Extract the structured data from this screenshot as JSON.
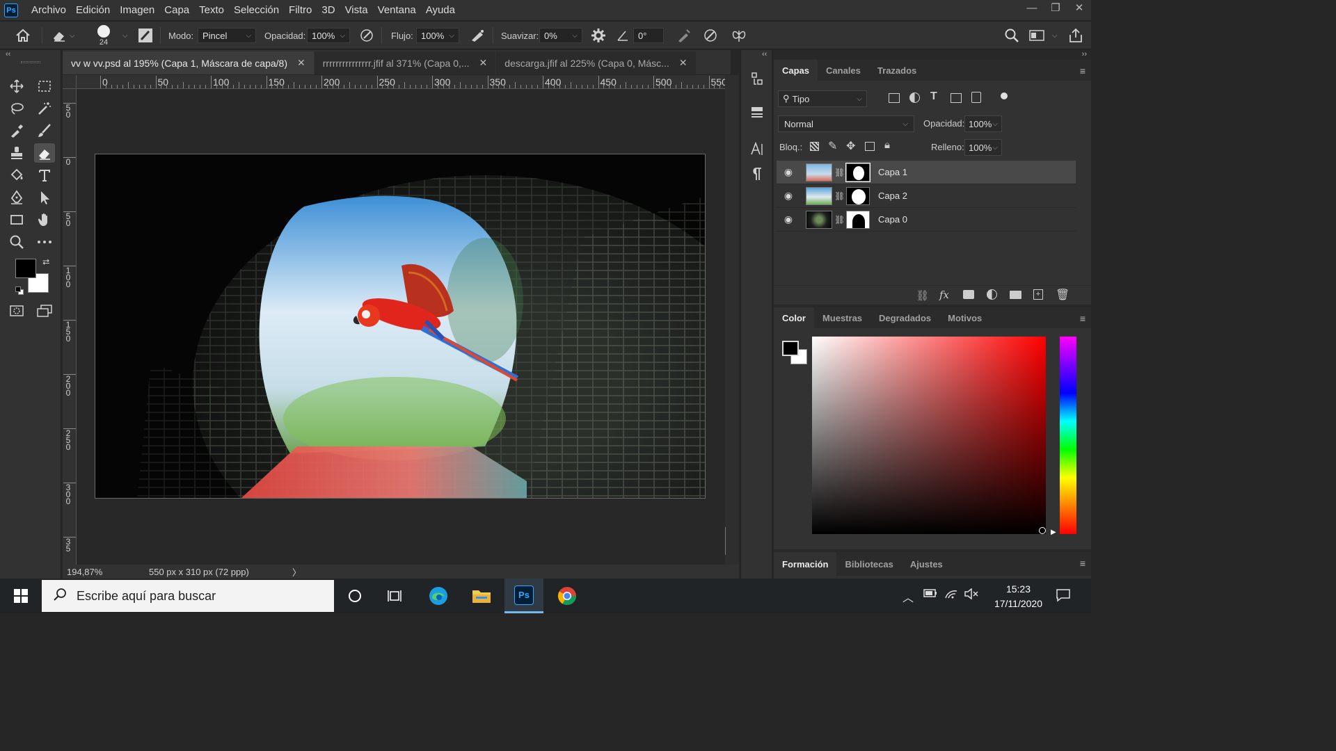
{
  "app": {
    "logo": "Ps",
    "menus": [
      "Archivo",
      "Edición",
      "Imagen",
      "Capa",
      "Texto",
      "Selección",
      "Filtro",
      "3D",
      "Vista",
      "Ventana",
      "Ayuda"
    ]
  },
  "options_bar": {
    "brush_size": "24",
    "mode_label": "Modo:",
    "mode_value": "Pincel",
    "opacity_label": "Opacidad:",
    "opacity_value": "100%",
    "flow_label": "Flujo:",
    "flow_value": "100%",
    "smoothing_label": "Suavizar:",
    "smoothing_value": "0%",
    "angle_value": "0°"
  },
  "document_tabs": [
    {
      "label": "vv w vv.psd al 195% (Capa 1, Máscara de capa/8)",
      "active": true
    },
    {
      "label": "rrrrrrrrrrrrrrr.jfif al 371% (Capa 0,...",
      "active": false
    },
    {
      "label": "descarga.jfif al 225% (Capa 0, Másc...",
      "active": false
    }
  ],
  "rulers": {
    "top_labels": [
      "0",
      "50",
      "100",
      "150",
      "200",
      "250",
      "300",
      "350",
      "400",
      "450",
      "500",
      "550"
    ],
    "left_labels": [
      "5\n0",
      "0",
      "5\n0",
      "1\n0\n0",
      "1\n5\n0",
      "2\n0\n0",
      "2\n5\n0",
      "3\n0\n0",
      "3\n5"
    ]
  },
  "status_bar": {
    "zoom": "194,87%",
    "doc_info": "550 px x 310 px (72 ppp)",
    "arrow": "〉"
  },
  "layers_panel": {
    "tabs": [
      "Capas",
      "Canales",
      "Trazados"
    ],
    "active_tab": "Capas",
    "filter_kind": "Tipo",
    "blend_mode": "Normal",
    "opacity_label": "Opacidad:",
    "opacity_value": "100%",
    "lock_label": "Bloq.:",
    "fill_label": "Relleno:",
    "fill_value": "100%",
    "layers": [
      {
        "name": "Capa 1",
        "visible": true,
        "selected": true
      },
      {
        "name": "Capa 2",
        "visible": true,
        "selected": false
      },
      {
        "name": "Capa 0",
        "visible": true,
        "selected": false
      }
    ]
  },
  "color_panel": {
    "tabs": [
      "Color",
      "Muestras",
      "Degradados",
      "Motivos"
    ],
    "active_tab": "Color",
    "foreground": "#000000",
    "background": "#ffffff",
    "hue_color": "#ff0000"
  },
  "learn_panel": {
    "tabs": [
      "Formación",
      "Bibliotecas",
      "Ajustes"
    ],
    "active_tab": "Formación"
  },
  "taskbar": {
    "search_placeholder": "Escribe aquí para buscar",
    "time": "15:23",
    "date": "17/11/2020"
  }
}
